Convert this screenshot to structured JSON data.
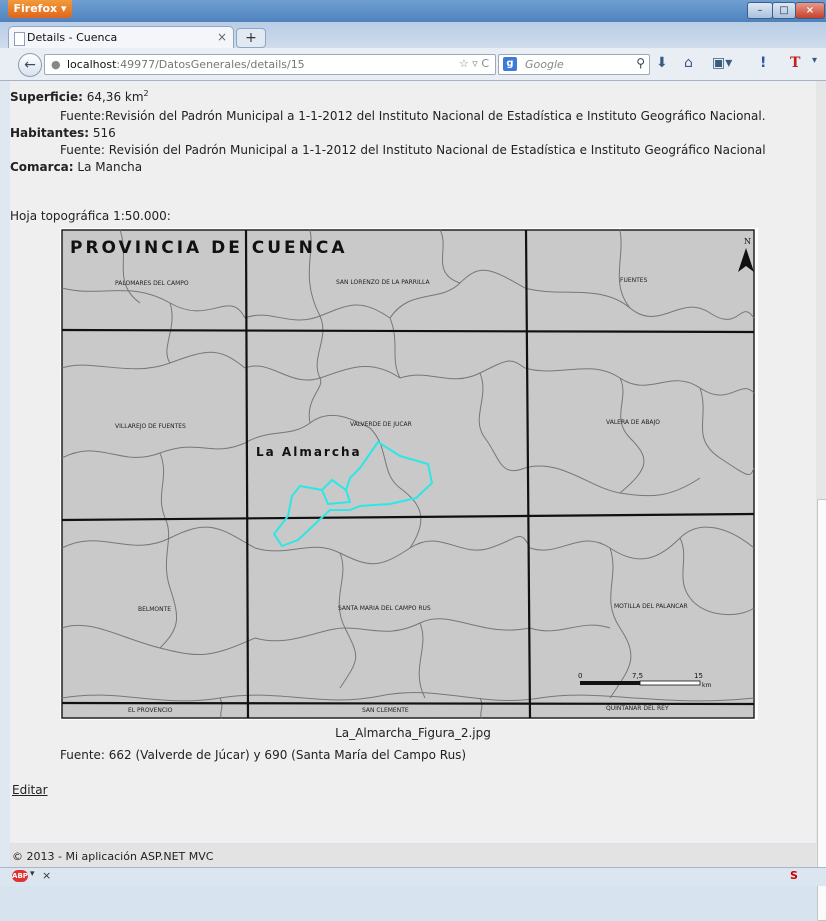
{
  "window": {
    "app_button": "Firefox",
    "minimize_glyph": "–",
    "maximize_glyph": "□",
    "close_glyph": "×"
  },
  "tab": {
    "title": "Details - Cuenca",
    "close_glyph": "×",
    "new_tab_glyph": "+"
  },
  "address": {
    "host": "localhost",
    "rest": ":49977/DatosGenerales/details/15"
  },
  "search": {
    "engine": "g",
    "placeholder": "Google"
  },
  "details": {
    "superficie_label": "Superficie:",
    "superficie_value": "64,36 km",
    "superficie_unit_sup": "2",
    "superficie_fuente": "Fuente:Revisión del Padrón Municipal a 1-1-2012 del Instituto Nacional de Estadística e Instituto Geográfico Nacional.",
    "habitantes_label": "Habitantes:",
    "habitantes_value": "516",
    "habitantes_fuente": "Fuente: Revisión del Padrón Municipal a 1-1-2012 del Instituto Nacional de Estadística e Instituto Geográfico Nacional",
    "comarca_label": "Comarca:",
    "comarca_value": "La Mancha",
    "hoja_label": "Hoja topográfica 1:50.000:"
  },
  "map": {
    "title": "PROVINCIA DE CUENCA",
    "highlight_label": "La Almarcha",
    "north": "N",
    "places": {
      "palomares": "PALOMARES DEL CAMPO",
      "san_lorenzo": "SAN LORENZO DE LA PARRILLA",
      "fuentes": "FUENTES",
      "villarejo": "VILLAREJO DE FUENTES",
      "valverde": "VALVERDE DE JUCAR",
      "valera": "VALERA DE ABAJO",
      "belmonte": "BELMONTE",
      "santa_maria": "SANTA MARIA DEL CAMPO RUS",
      "motilla": "MOTILLA DEL PALANCAR",
      "el_provencio": "EL PROVENCIO",
      "san_clemente": "SAN CLEMENTE",
      "quintanar": "QUINTANAR DEL REY"
    },
    "scale": {
      "zero": "0",
      "mid": "7,5",
      "end": "15",
      "unit": "km"
    },
    "highlight_color": "#2ee6e6"
  },
  "caption": "La_Almarcha_Figura_2.jpg",
  "map_fuente": "Fuente: 662 (Valverde de Júcar) y 690 (Santa María del Campo Rus)",
  "editar": "Editar",
  "footer": "© 2013 - Mi aplicación ASP.NET MVC",
  "status": {
    "badge": "ABP",
    "arrow": "▾",
    "close": "×",
    "right": "S"
  }
}
